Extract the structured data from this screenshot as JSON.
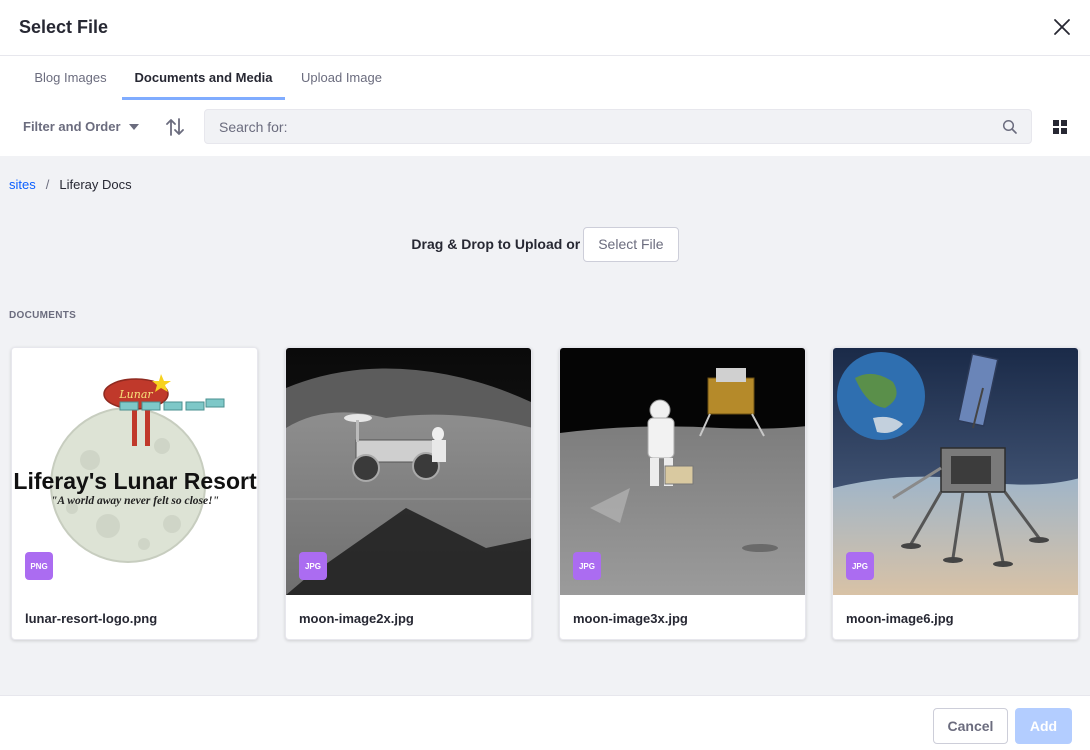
{
  "modal": {
    "title": "Select File",
    "close_icon": "close-icon"
  },
  "tabs": [
    {
      "label": "Blog Images",
      "active": false
    },
    {
      "label": "Documents and Media",
      "active": true
    },
    {
      "label": "Upload Image",
      "active": false
    }
  ],
  "toolbar": {
    "filter_label": "Filter and Order",
    "sort_icon": "sort-icon",
    "search_placeholder": "Search for:",
    "search_icon": "search-icon",
    "view_icon": "grid-view-icon"
  },
  "breadcrumb": {
    "items": [
      {
        "label": "sites",
        "link": true
      },
      {
        "label": "Liferay Docs",
        "link": false
      }
    ],
    "separator": "/"
  },
  "dropzone": {
    "text": "Drag & Drop to Upload or",
    "button_label": "Select File"
  },
  "documents": {
    "section_label": "DOCUMENTS",
    "items": [
      {
        "name": "lunar-resort-logo.png",
        "type": "PNG",
        "logo_line1": "Liferay's Lunar Resort",
        "logo_line2": "\"A world away never felt so close!\"",
        "sign_text": "Lunar"
      },
      {
        "name": "moon-image2x.jpg",
        "type": "JPG"
      },
      {
        "name": "moon-image3x.jpg",
        "type": "JPG"
      },
      {
        "name": "moon-image6.jpg",
        "type": "JPG"
      }
    ]
  },
  "footer": {
    "cancel_label": "Cancel",
    "add_label": "Add"
  },
  "colors": {
    "accent": "#0b5fff",
    "tab_indicator": "#80acff",
    "badge": "#ab6cf1",
    "add_disabled": "#b3cdff"
  }
}
